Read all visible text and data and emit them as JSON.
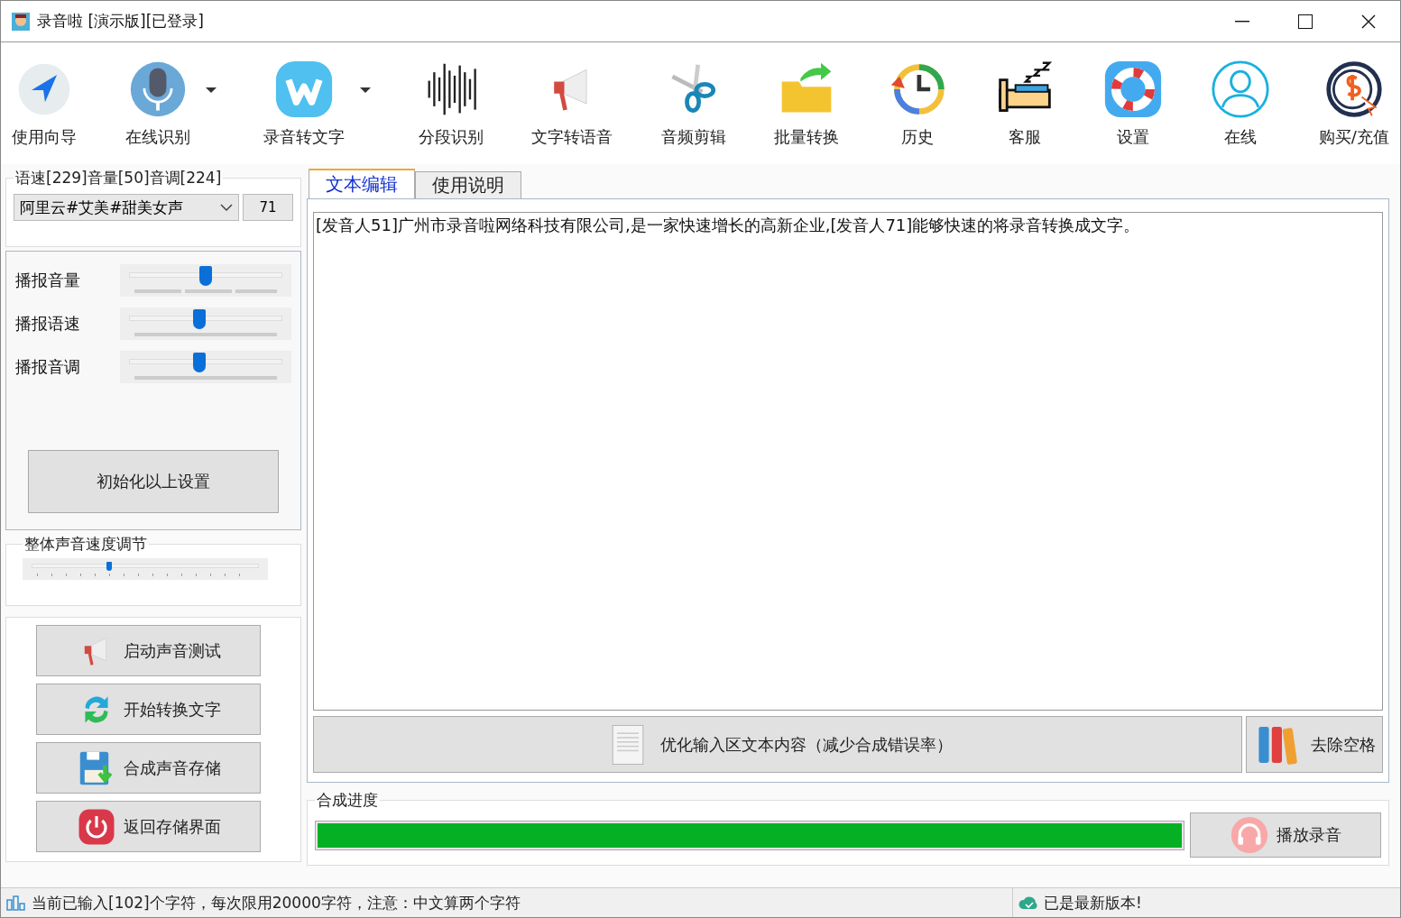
{
  "window": {
    "title": "录音啦 [演示版][已登录]"
  },
  "toolbar": [
    {
      "label": "使用向导",
      "has_menu": false
    },
    {
      "label": "在线识别",
      "has_menu": true
    },
    {
      "label": "录音转文字",
      "has_menu": true
    },
    {
      "label": "分段识别",
      "has_menu": false
    },
    {
      "label": "文字转语音",
      "has_menu": false
    },
    {
      "label": "音频剪辑",
      "has_menu": false
    },
    {
      "label": "批量转换",
      "has_menu": false
    },
    {
      "label": "历史",
      "has_menu": false
    },
    {
      "label": "客服",
      "has_menu": false
    },
    {
      "label": "设置",
      "has_menu": false
    },
    {
      "label": "在线",
      "has_menu": false
    },
    {
      "label": "购买/充值",
      "has_menu": false
    }
  ],
  "voice_group": {
    "legend": "语速[229]音量[50]音调[224]",
    "voice": "阿里云#艾美#甜美女声",
    "voice_number": "71"
  },
  "sliders": [
    {
      "label": "播报音量",
      "level": 0.5
    },
    {
      "label": "播报语速",
      "level": 0.46
    },
    {
      "label": "播报音调",
      "level": 0.46
    }
  ],
  "reset_button": "初始化以上设置",
  "overall_speed": {
    "legend": "整体声音速度调节",
    "level": 0.34
  },
  "actions": [
    "启动声音测试",
    "开始转换文字",
    "合成声音存储",
    "返回存储界面"
  ],
  "tabs": [
    {
      "label": "文本编辑",
      "selected": true
    },
    {
      "label": "使用说明",
      "selected": false
    }
  ],
  "editor": {
    "value": "[发音人51]广州市录音啦网络科技有限公司,是一家快速增长的高新企业,[发音人71]能够快速的将录音转换成文字。"
  },
  "editor_buttons": [
    "优化输入区文本内容（减少合成错误率）",
    "去除空格"
  ],
  "progress": {
    "legend": "合成进度",
    "level": 1,
    "play_button": "播放录音"
  },
  "status_bar": {
    "left": "当前已输入[102]个字符，每次限用20000字符，注意：中文算两个字符",
    "right": "已是最新版本!"
  }
}
